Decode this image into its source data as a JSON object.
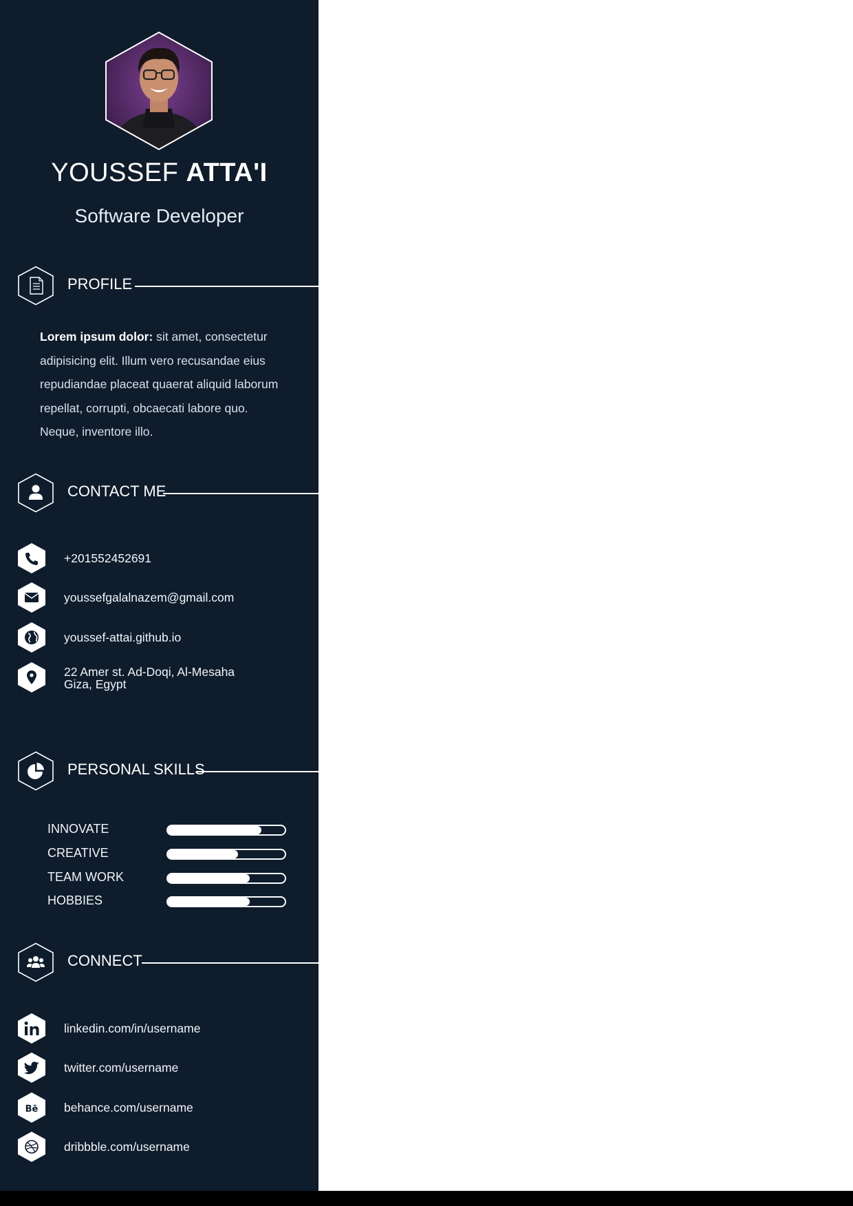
{
  "person": {
    "first_name": "YOUSSEF",
    "last_name": "ATTA'I",
    "role": "Software Developer"
  },
  "profile": {
    "heading": "PROFILE",
    "lead": "Lorem ipsum dolor:",
    "body": " sit amet, consectetur adipisicing elit. Illum vero recusandae eius repudiandae placeat quaerat aliquid laborum repellat, corrupti, obcaecati labore quo. Neque, inventore illo."
  },
  "contact": {
    "heading": "CONTACT ME",
    "items": [
      {
        "icon": "phone-icon",
        "text": "+201552452691"
      },
      {
        "icon": "envelope-icon",
        "text": "youssefgalalnazem@gmail.com"
      },
      {
        "icon": "globe-icon",
        "text": "youssef-attai.github.io"
      },
      {
        "icon": "map-pin-icon",
        "line1": "22 Amer st. Ad-Doqi, Al-Mesaha",
        "line2": "Giza, Egypt"
      }
    ]
  },
  "skills": {
    "heading": "PERSONAL SKILLS",
    "items": [
      {
        "label": "INNOVATE",
        "level": 0.8
      },
      {
        "label": "CREATIVE",
        "level": 0.6
      },
      {
        "label": "TEAM WORK",
        "level": 0.7
      },
      {
        "label": "HOBBIES",
        "level": 0.7
      }
    ]
  },
  "connect": {
    "heading": "CONNECT",
    "items": [
      {
        "icon": "linkedin-icon",
        "text": "linkedin.com/in/username"
      },
      {
        "icon": "twitter-icon",
        "text": "twitter.com/username"
      },
      {
        "icon": "behance-icon",
        "text": "behance.com/username"
      },
      {
        "icon": "dribbble-icon",
        "text": "dribbble.com/username"
      }
    ]
  },
  "colors": {
    "sidebar": "#0e1c2c",
    "page": "#ffffff",
    "accent": "#ffffff"
  }
}
